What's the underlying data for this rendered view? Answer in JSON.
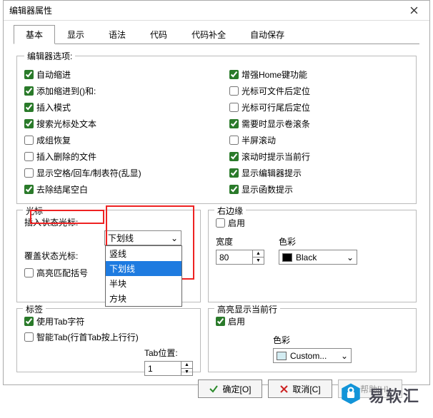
{
  "title": "编辑器属性",
  "tabs": [
    "基本",
    "显示",
    "语法",
    "代码",
    "代码补全",
    "自动保存"
  ],
  "activeTab": 0,
  "options_legend": "编辑器选项:",
  "leftChecks": [
    {
      "label": "自动缩进",
      "checked": true
    },
    {
      "label": "添加缩进到()和:",
      "checked": true
    },
    {
      "label": "插入模式",
      "checked": true
    },
    {
      "label": "搜索光标处文本",
      "checked": true
    },
    {
      "label": "成组恢复",
      "checked": false
    },
    {
      "label": "插入删除的文件",
      "checked": false
    },
    {
      "label": "显示空格/回车/制表符(乱显)",
      "checked": false
    },
    {
      "label": "去除结尾空白",
      "checked": true
    }
  ],
  "rightChecks": [
    {
      "label": "增强Home键功能",
      "checked": true
    },
    {
      "label": "光标可文件后定位",
      "checked": false
    },
    {
      "label": "光标可行尾后定位",
      "checked": false
    },
    {
      "label": "需要时显示卷滚条",
      "checked": true
    },
    {
      "label": "半屏滚动",
      "checked": false
    },
    {
      "label": "滚动时提示当前行",
      "checked": true
    },
    {
      "label": "显示编辑器提示",
      "checked": true
    },
    {
      "label": "显示函数提示",
      "checked": true
    }
  ],
  "cursor": {
    "legend": "光标",
    "insertLabel": "插入状态光标:",
    "insertValue": "下划线",
    "options": [
      "竖线",
      "下划线",
      "半块",
      "方块"
    ],
    "overwriteLabel": "覆盖状态光标:",
    "highlightMatch": {
      "label": "高亮匹配括号",
      "checked": false
    }
  },
  "rightMargin": {
    "legend": "右边缘",
    "enable": {
      "label": "启用",
      "checked": false
    },
    "widthLabel": "宽度",
    "widthValue": "80",
    "colorLabel": "色彩",
    "colorValue": "Black",
    "colorHex": "#000000"
  },
  "tags": {
    "legend": "标签",
    "useTab": {
      "label": "使用Tab字符",
      "checked": true
    },
    "smartTab": {
      "label": "智能Tab(行首Tab按上行行)",
      "checked": false
    },
    "tabPosLabel": "Tab位置:",
    "tabPosValue": "1"
  },
  "highlight": {
    "legend": "高亮显示当前行",
    "enable": {
      "label": "启用",
      "checked": true
    },
    "colorLabel": "色彩",
    "colorValue": "Custom...",
    "colorHex": "#d3ecf2"
  },
  "buttons": {
    "ok": "确定[O]",
    "cancel": "取消[C]",
    "help": "帮助[H]"
  },
  "brand": "易软汇"
}
